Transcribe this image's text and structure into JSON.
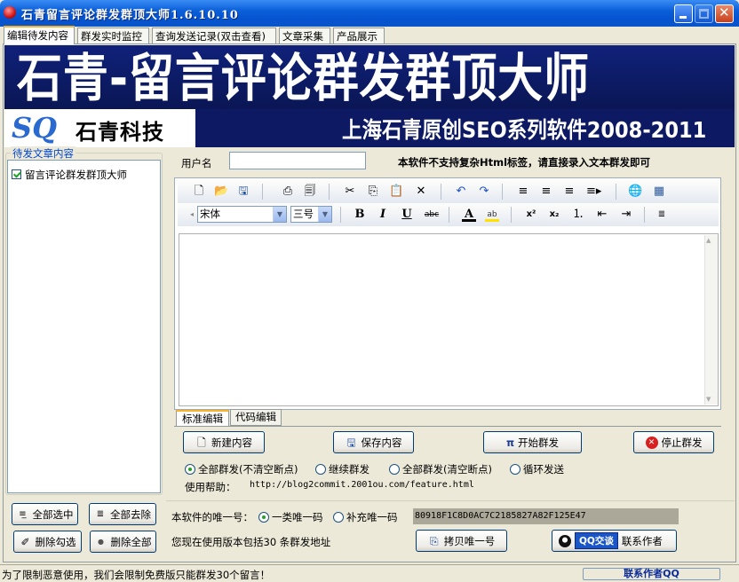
{
  "window": {
    "title": "石青留言评论群发群顶大师1.6.10.10"
  },
  "tabs": [
    {
      "label": "编辑待发内容",
      "active": true
    },
    {
      "label": "群发实时监控"
    },
    {
      "label": "查询发送记录(双击查看)"
    },
    {
      "label": "文章采集"
    },
    {
      "label": "产品展示"
    }
  ],
  "banner": {
    "title": "石青-留言评论群发群顶大师",
    "subtitle": "上海石青原创SEO系列软件2008-2011",
    "logo_mark": "SQ",
    "logo_name": "石青科技"
  },
  "left_panel": {
    "legend": "待发文章内容",
    "items": [
      "留言评论群发群顶大师"
    ],
    "buttons": {
      "select_all": "全部选中",
      "remove_all": "全部去除",
      "delete_checked": "删除勾选",
      "delete_all": "删除全部"
    }
  },
  "form": {
    "user_label": "用户名",
    "user_value": "",
    "notice": "本软件不支持复杂Html标签，请直接录入文本群发即可"
  },
  "editor": {
    "font_name": "宋体",
    "font_size": "三号",
    "tab_standard": "标准编辑",
    "tab_code": "代码编辑",
    "bold_glyph": "B",
    "italic_glyph": "I",
    "underline_glyph": "U",
    "strike_glyph": "abc",
    "font_color_glyph": "A",
    "highlight_glyph": "ab"
  },
  "actions": {
    "new": "新建内容",
    "save": "保存内容",
    "start": "开始群发",
    "stop": "停止群发",
    "start_symbol": "π"
  },
  "send_modes": [
    {
      "label": "全部群发(不清空断点)",
      "selected": true
    },
    {
      "label": "继续群发",
      "selected": false
    },
    {
      "label": "全部群发(清空断点)",
      "selected": false
    },
    {
      "label": "循环发送",
      "selected": false
    }
  ],
  "help": {
    "label": "使用帮助：",
    "url": "http://blog2commit.2001ou.com/feature.html"
  },
  "unique_id": {
    "label": "本软件的唯一号：",
    "options": [
      {
        "label": "一类唯一码",
        "selected": true
      },
      {
        "label": "补充唯一码",
        "selected": false
      }
    ],
    "value": "80918F1C8D0AC7C2185827A82F125E47",
    "copy_button": "拷贝唯一号"
  },
  "usage": {
    "prefix": "您现在使用版本包括",
    "count": "30",
    "suffix": "条群发地址"
  },
  "contact": {
    "qq_button": "QQ交谈",
    "label": "联系作者"
  },
  "statusbar": {
    "text": "为了限制恶意使用，我们会限制免费版只能群发30个留言！",
    "link": "联系作者QQ"
  },
  "colors": {
    "titlebar": "#0a5fd8",
    "banner_bg": "#0d1a63",
    "accent_tab": "#f7b32a"
  }
}
